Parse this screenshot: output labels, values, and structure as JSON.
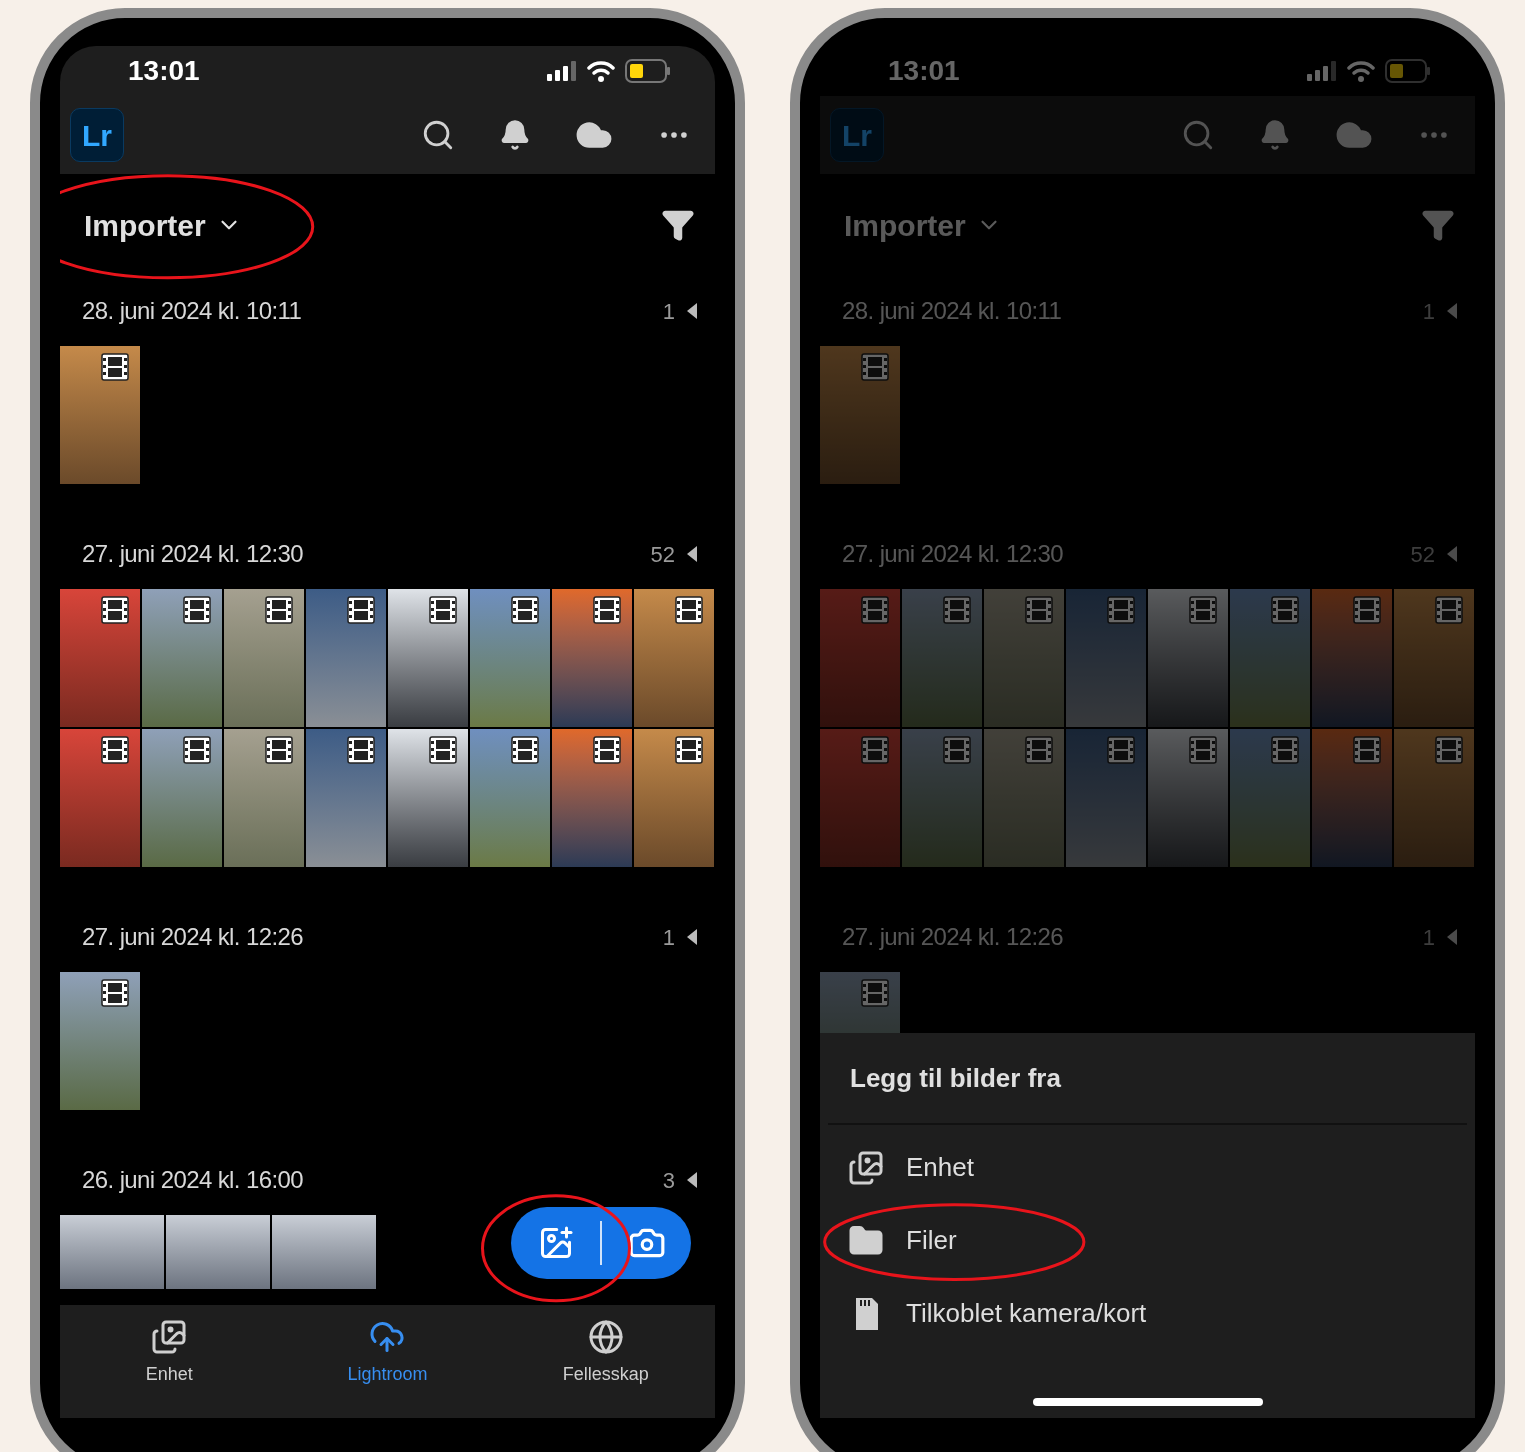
{
  "phones": [
    {
      "status_bar": {
        "time": "13:01"
      },
      "header": {
        "logo": "Lr"
      },
      "title": {
        "text": "Importer",
        "circled": true
      },
      "groups": [
        {
          "date": "28. juni 2024 kl. 10:11",
          "count": "1",
          "thumbnails": [
            {
              "kind": "portrait",
              "video": true
            }
          ]
        },
        {
          "date": "27. juni 2024 kl. 12:30",
          "count": "52",
          "thumbnails": [
            {
              "kind": "portrait",
              "video": true
            },
            {
              "kind": "portrait",
              "video": true
            },
            {
              "kind": "portrait",
              "video": true
            },
            {
              "kind": "portrait",
              "video": true
            },
            {
              "kind": "portrait",
              "video": true
            },
            {
              "kind": "portrait",
              "video": true
            },
            {
              "kind": "portrait",
              "video": true
            },
            {
              "kind": "portrait",
              "video": true
            },
            {
              "kind": "portrait",
              "video": true
            },
            {
              "kind": "portrait",
              "video": true
            },
            {
              "kind": "portrait",
              "video": true
            },
            {
              "kind": "portrait",
              "video": true
            },
            {
              "kind": "portrait",
              "video": true
            },
            {
              "kind": "portrait",
              "video": true
            },
            {
              "kind": "portrait",
              "video": true
            },
            {
              "kind": "portrait",
              "video": true
            }
          ]
        },
        {
          "date": "27. juni 2024 kl. 12:26",
          "count": "1",
          "thumbnails": [
            {
              "kind": "portrait",
              "video": true
            }
          ]
        },
        {
          "date": "26. juni 2024 kl. 16:00",
          "count": "3",
          "thumbnails": [
            {
              "kind": "landscape"
            },
            {
              "kind": "landscape"
            },
            {
              "kind": "landscape"
            }
          ]
        }
      ],
      "import_buttons": {
        "circled": true
      },
      "nav": [
        {
          "label": "Enhet",
          "kind": "device",
          "selected": false
        },
        {
          "label": "Lightroom",
          "kind": "cloud",
          "selected": true
        },
        {
          "label": "Fellesskap",
          "kind": "globe",
          "selected": false
        }
      ]
    },
    {
      "status_bar": {
        "time": "13:01"
      },
      "header": {
        "logo": "Lr"
      },
      "title": {
        "text": "Importer"
      },
      "dimmed": true,
      "groups": [
        {
          "date": "28. juni 2024 kl. 10:11",
          "count": "1",
          "thumbnails": [
            {
              "kind": "portrait",
              "video": true
            }
          ]
        },
        {
          "date": "27. juni 2024 kl. 12:30",
          "count": "52",
          "thumbnails": [
            {
              "kind": "portrait",
              "video": true
            },
            {
              "kind": "portrait",
              "video": true
            },
            {
              "kind": "portrait",
              "video": true
            },
            {
              "kind": "portrait",
              "video": true
            },
            {
              "kind": "portrait",
              "video": true
            },
            {
              "kind": "portrait",
              "video": true
            },
            {
              "kind": "portrait",
              "video": true
            },
            {
              "kind": "portrait",
              "video": true
            },
            {
              "kind": "portrait",
              "video": true
            },
            {
              "kind": "portrait",
              "video": true
            },
            {
              "kind": "portrait",
              "video": true
            },
            {
              "kind": "portrait",
              "video": true
            },
            {
              "kind": "portrait",
              "video": true
            },
            {
              "kind": "portrait",
              "video": true
            },
            {
              "kind": "portrait",
              "video": true
            },
            {
              "kind": "portrait",
              "video": true
            }
          ]
        },
        {
          "date": "27. juni 2024 kl. 12:26",
          "count": "1",
          "thumbnails": [
            {
              "kind": "portrait",
              "video": true
            }
          ]
        }
      ],
      "sheet": {
        "title": "Legg til bilder fra",
        "items": [
          {
            "label": "Enhet",
            "kind": "device"
          },
          {
            "label": "Filer",
            "kind": "folder",
            "circled": true
          },
          {
            "label": "Tilkoblet kamera/kort",
            "kind": "card"
          }
        ]
      }
    }
  ]
}
